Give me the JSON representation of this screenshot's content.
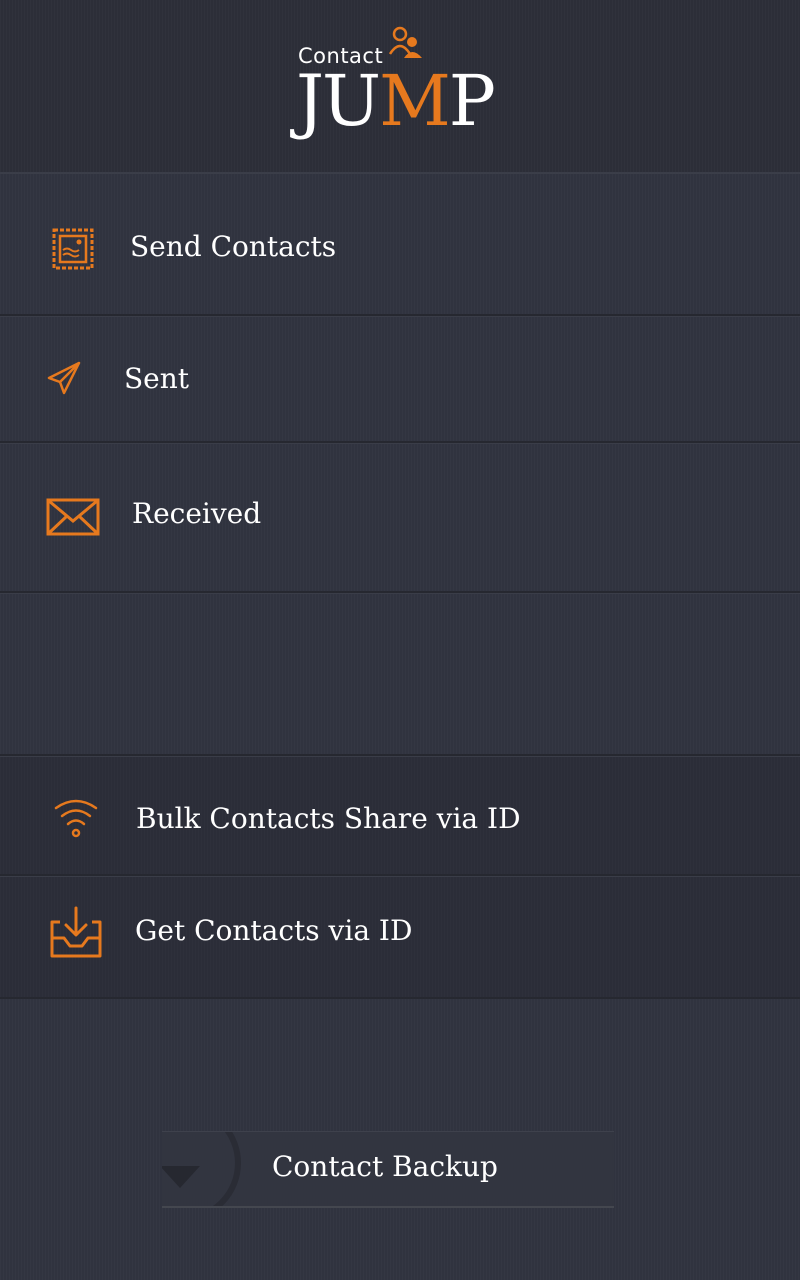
{
  "logo": {
    "contact": "Contact",
    "jump_prefix": "JU",
    "jump_m": "M",
    "jump_suffix": "P",
    "accent_color": "#e6791e"
  },
  "menu": {
    "send_contacts": {
      "label": "Send Contacts",
      "icon": "stamp-icon"
    },
    "sent": {
      "label": "Sent",
      "icon": "paper-plane-icon"
    },
    "received": {
      "label": "Received",
      "icon": "envelope-icon"
    },
    "bulk_share": {
      "label": "Bulk Contacts Share via ID",
      "icon": "wifi-icon"
    },
    "get_contacts": {
      "label": "Get Contacts via ID",
      "icon": "download-tray-icon"
    }
  },
  "backup": {
    "label": "Contact Backup",
    "icon": "download-arrow-icon"
  },
  "colors": {
    "background": "#30333f",
    "accent": "#e6791e",
    "text": "#ffffff"
  }
}
